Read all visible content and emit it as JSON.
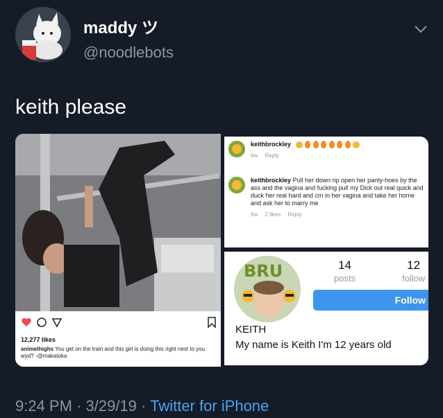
{
  "tweet": {
    "display_name": "maddy ツ",
    "handle": "@noodlebots",
    "text": "keith please",
    "time": "9:24 PM",
    "date": "3/29/19",
    "separator": "·",
    "source": "Twitter for iPhone"
  },
  "instagram_post": {
    "likes": "12,277 likes",
    "caption_user": "animethighs",
    "caption_text": "You get on the train and this girl is doing this right next to you wyd? -@makatoka"
  },
  "comments": [
    {
      "user": "keithbrockley",
      "text": "",
      "age": "6w",
      "likes": "",
      "reply_label": "Reply"
    },
    {
      "user": "keithbrockley",
      "text": "Pull her down rip open her panty-hoes by the ass and the vagina and fucking pull my Dick out real quick and duck her real hard and cm in her vagina and take her home and ask her to marry me",
      "age": "6w",
      "likes": "2 likes",
      "reply_label": "Reply"
    }
  ],
  "profile": {
    "posts_count": "14",
    "posts_label": "posts",
    "followers_count": "12",
    "followers_label": "follow",
    "follow_button": "Follow",
    "name": "KEITH",
    "bio": "My name is Keith I'm 12 years old",
    "pic_text": "BRU"
  },
  "colors": {
    "background": "#151b27",
    "secondary_text": "#8a96a8",
    "link": "#4aa2ee",
    "follow_button": "#3d95ee",
    "like_heart": "#ed4956"
  },
  "icons": [
    "chevron-down-icon",
    "heart-icon",
    "comment-icon",
    "share-icon",
    "bookmark-icon",
    "fire-emoji-icon",
    "smiley-emoji-icon"
  ]
}
